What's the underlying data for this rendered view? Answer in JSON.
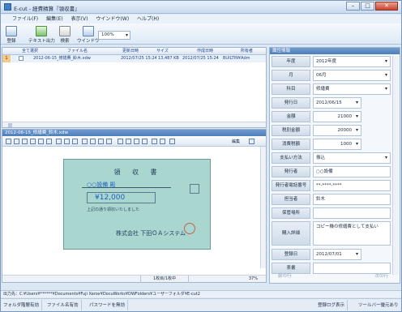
{
  "window": {
    "title": "E-cut - 経費精算『領収書』"
  },
  "menu": [
    "ファイル(F)",
    "編集(E)",
    "表示(V)",
    "ウインドウ(W)",
    "ヘルプ(H)"
  ],
  "toolbar": {
    "buttons": [
      {
        "label": "登録",
        "icon": "register-icon"
      },
      {
        "label": "テキスト出力",
        "icon": "text-export-icon"
      },
      {
        "label": "検索",
        "icon": "search-house-icon"
      },
      {
        "label": "ウインドウ",
        "icon": "window-icon"
      }
    ],
    "zoom": "100%"
  },
  "list": {
    "headers": [
      "全て選択",
      "ファイル名",
      "更新日時",
      "サイズ",
      "作成日時",
      "所有者"
    ],
    "rows": [
      {
        "num": "1",
        "filename": "2012-06-15_修繕費_鈴木.xdw",
        "updated": "2012/07/25 15:24",
        "size": "13,487 KB",
        "created": "2012/07/25 15:24",
        "owner": "BUILTIN¥Adm"
      }
    ]
  },
  "viewer": {
    "title": "2012-06-15_修繕費_鈴木.xdw",
    "edit_label": "編集",
    "page_info": "1枚目/1枚中",
    "zoom": "37%",
    "receipt": {
      "title": "領 収 書",
      "name": "○○設備 殿",
      "amount": "¥12,000",
      "note": "上記の通り領収いたしました",
      "company": "株式会社 下田ＯＡシステム"
    }
  },
  "props": {
    "title": "属性情報",
    "fields": [
      {
        "label": "年度",
        "value": "2012年度",
        "kind": "drop"
      },
      {
        "label": "月",
        "value": "06月",
        "kind": "drop"
      },
      {
        "label": "科目",
        "value": "修繕費",
        "kind": "drop"
      },
      {
        "label": "発行日",
        "value": "2012/06/15",
        "kind": "date"
      },
      {
        "label": "金額",
        "value": "21000",
        "kind": "num"
      },
      {
        "label": "税別金額",
        "value": "20000",
        "kind": "num"
      },
      {
        "label": "消費税額",
        "value": "1000",
        "kind": "num"
      },
      {
        "label": "支払い方法",
        "value": "振込",
        "kind": "drop"
      },
      {
        "label": "発行者",
        "value": "○○設備",
        "kind": "text"
      },
      {
        "label": "発行者電話番号",
        "value": "**-****-****",
        "kind": "text"
      },
      {
        "label": "担当者",
        "value": "鈴木",
        "kind": "text"
      },
      {
        "label": "保管場所",
        "value": "",
        "kind": "text"
      },
      {
        "label": "購入詳細",
        "value": "コピー機の修繕費として支払い",
        "kind": "tall"
      },
      {
        "label": "登録日",
        "value": "2012/07/01",
        "kind": "date"
      },
      {
        "label": "表書",
        "value": "",
        "kind": "text"
      }
    ],
    "prev": "前の行",
    "next": "次の行"
  },
  "path": "出力先：C:¥Users¥******¥Documents¥Fuji Xerox¥DocuWorks¥DWFolders¥ユーザーフォルダ¥E-cut2",
  "statusbar": {
    "items": [
      "フォルダ階層有効",
      "ファイル名有効",
      "パスワードを無効",
      "登録ログ表示",
      "ツールバー優元あり"
    ]
  }
}
